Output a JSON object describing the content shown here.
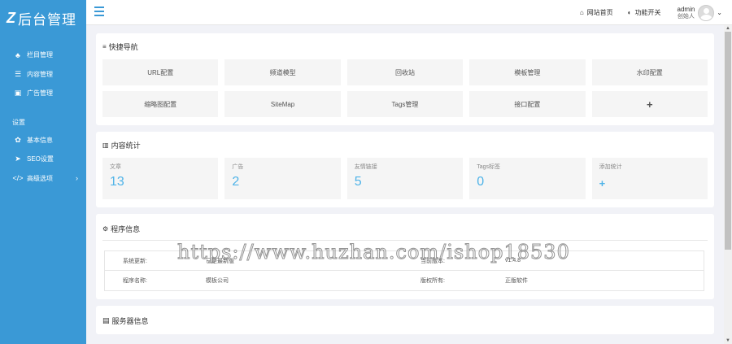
{
  "brand": {
    "logo_mark": "Z",
    "title": "后台管理"
  },
  "sidebar": {
    "items": [
      {
        "icon": "sitemap-icon",
        "glyph": "♣",
        "label": "栏目管理"
      },
      {
        "icon": "list-icon",
        "glyph": "☰",
        "label": "内容管理"
      },
      {
        "icon": "image-icon",
        "glyph": "▣",
        "label": "广告管理"
      }
    ],
    "group_label": "设置",
    "settings_items": [
      {
        "icon": "gear-icon",
        "glyph": "✿",
        "label": "基本信息"
      },
      {
        "icon": "send-icon",
        "glyph": "➤",
        "label": "SEO设置"
      },
      {
        "icon": "code-icon",
        "glyph": "</>",
        "label": "高级选项",
        "chevron": "›"
      }
    ]
  },
  "topbar": {
    "home_icon": "⌂",
    "home_label": "网站首页",
    "toggle_icon": "◐",
    "toggle_label": "功能开关",
    "user_name": "admin",
    "user_role": "创始人",
    "caret": "⌄"
  },
  "quick_nav": {
    "title_icon": "≡",
    "title": "快捷导航",
    "buttons": [
      "URL配置",
      "频道模型",
      "回收站",
      "模板管理",
      "水印配置",
      "缩略图配置",
      "SiteMap",
      "Tags管理",
      "接口配置",
      "+"
    ]
  },
  "stats": {
    "title_icon": "▥",
    "title": "内容统计",
    "items": [
      {
        "label": "文章",
        "value": "13"
      },
      {
        "label": "广告",
        "value": "2"
      },
      {
        "label": "友情链接",
        "value": "5"
      },
      {
        "label": "Tags标签",
        "value": "0"
      },
      {
        "label": "添加统计",
        "value": "+"
      }
    ]
  },
  "program_info": {
    "title_icon": "⚙",
    "title": "程序信息",
    "rows": [
      {
        "k1": "系统更新:",
        "v1": "已是最新版",
        "k2": "当前版本:",
        "v2": "v1.4.8"
      },
      {
        "k1": "程序名称:",
        "v1": "模板公司",
        "k2": "版权所有:",
        "v2": "正版软件"
      }
    ]
  },
  "next_section": {
    "title_icon": "▤",
    "title": "服务器信息"
  },
  "watermark": "https://www.huzhan.com/ishop18530",
  "colors": {
    "sidebar": "#3a99d6",
    "accent": "#4fb3e8",
    "background": "#f1f2f7"
  }
}
